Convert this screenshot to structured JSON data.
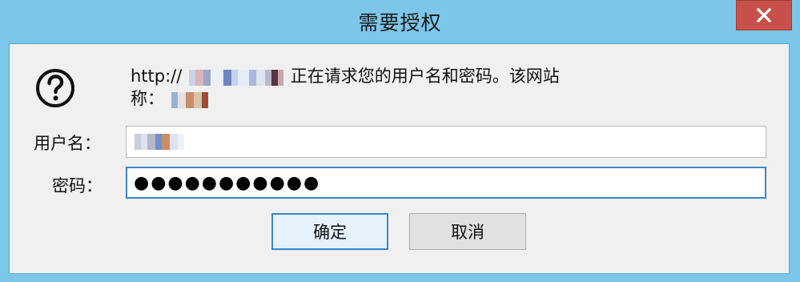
{
  "window": {
    "title": "需要授权"
  },
  "icons": {
    "close": "close-icon",
    "help": "question-circle-icon"
  },
  "message": {
    "prefix": "http://",
    "suffix": "正在请求您的用户名和密码。该网站",
    "line2_prefix": "称："
  },
  "form": {
    "username_label": "用户名：",
    "password_label": "密码：",
    "password_value": "●●●●●●●●●●●"
  },
  "buttons": {
    "ok": "确定",
    "cancel": "取消"
  },
  "colors": {
    "titlebar": "#7cc6ea",
    "close_button": "#c7504b",
    "client_bg": "#f0f0f0",
    "focus_border": "#3b86c6"
  }
}
